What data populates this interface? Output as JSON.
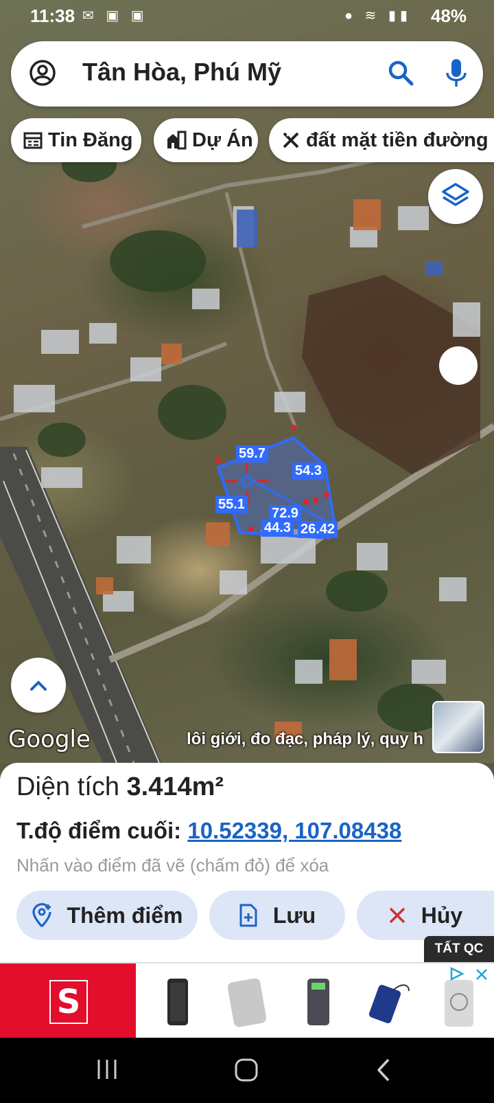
{
  "status_bar": {
    "time": "11:38",
    "battery": "48%"
  },
  "search": {
    "query": "Tân Hòa, Phú Mỹ"
  },
  "chips": [
    {
      "label": "Tin Đăng",
      "icon": "calendar-list-icon"
    },
    {
      "label": "Dự Án",
      "icon": "buildings-icon"
    },
    {
      "label": "đất mặt tiền đường s",
      "icon": "ruler-pencil-icon"
    }
  ],
  "map": {
    "brand": "Google",
    "ticker": "lôi giới, đo đạc, pháp lý, quy h",
    "measure_labels": [
      "59.7",
      "54.3",
      "55.1",
      "72.9",
      "44.3",
      "26.42"
    ],
    "polygon_color": "#2f6bff"
  },
  "panel": {
    "area_label": "Diện tích",
    "area_value": "3.414m²",
    "coord_label": "T.độ điểm cuối:",
    "coord_value": "10.52339, 107.08438",
    "hint": "Nhấn vào điểm đã vẽ (chấm đỏ) để xóa",
    "buttons": {
      "add": "Thêm điểm",
      "save": "Lưu",
      "cancel": "Hủy"
    }
  },
  "ad": {
    "close_ads_label": "TẤT QC",
    "brand_letter": "S",
    "brand_color": "#e30d2c"
  },
  "colors": {
    "accent_blue": "#1a63c7",
    "button_bg": "#dde6f7",
    "cancel_red": "#d32f2f"
  }
}
